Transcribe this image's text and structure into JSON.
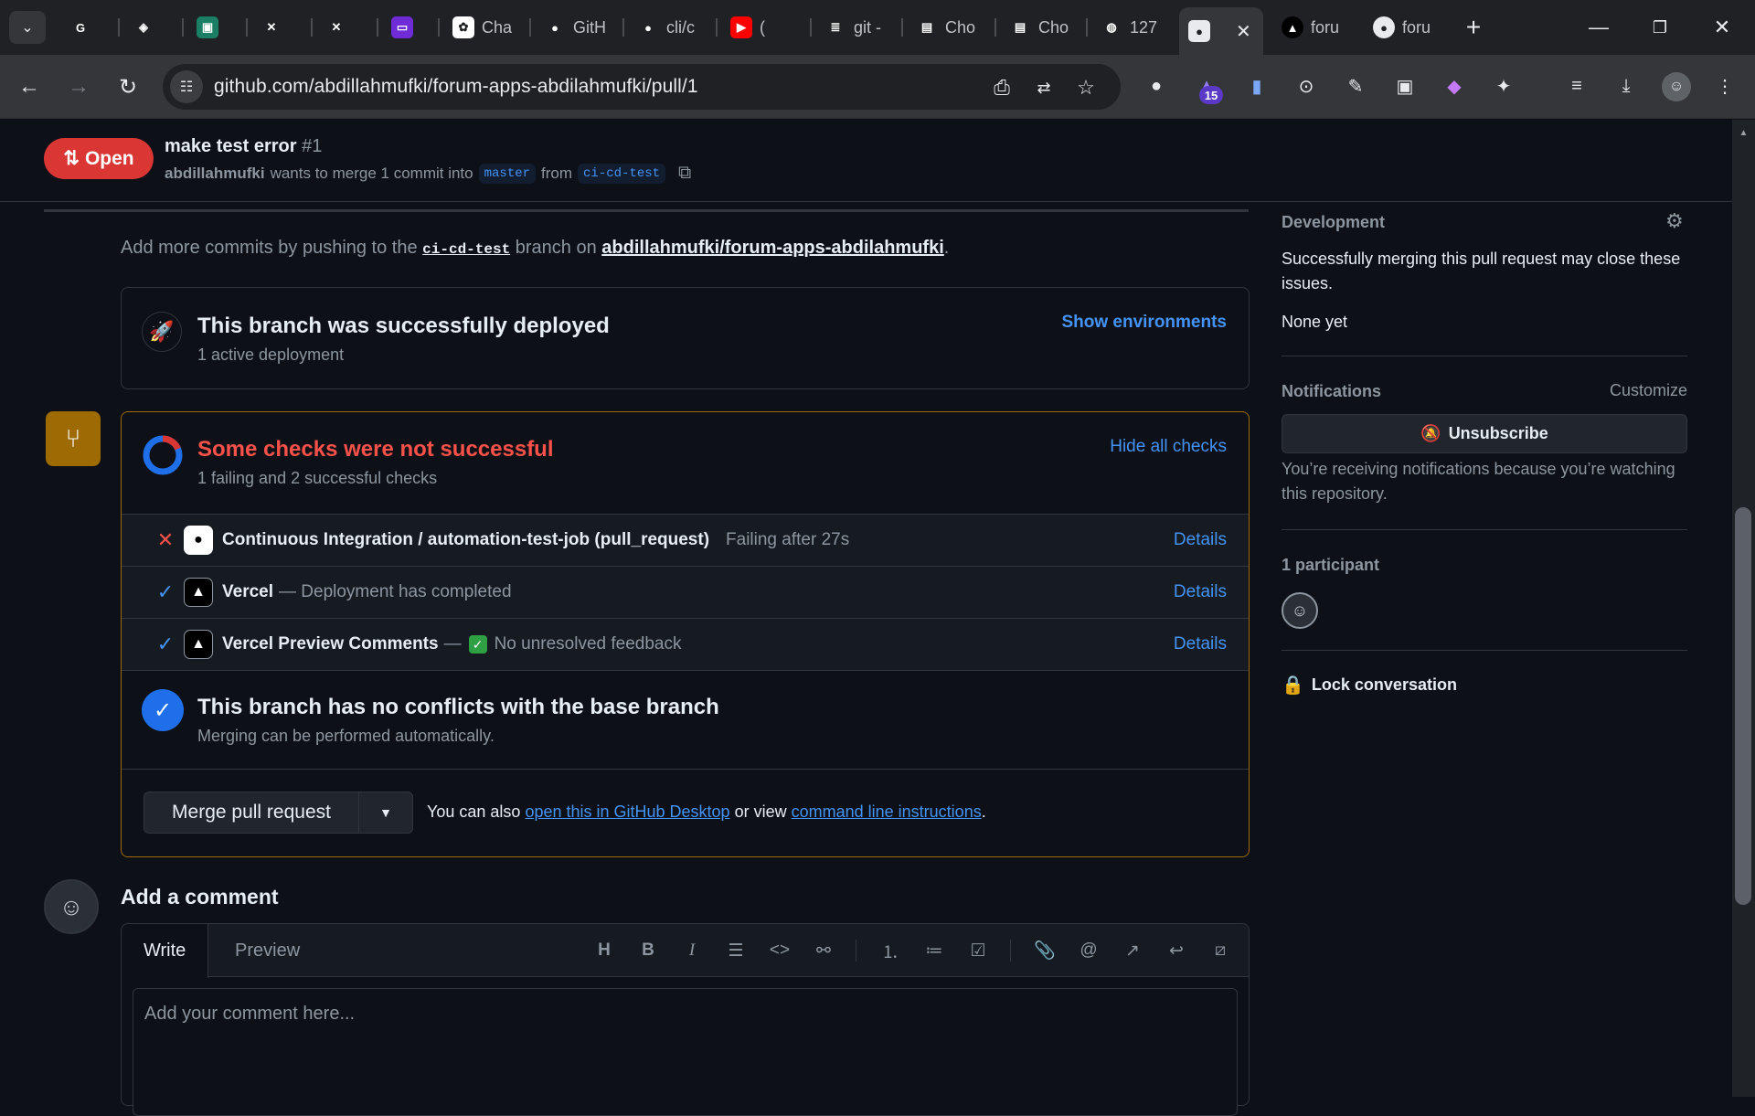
{
  "browser": {
    "tabs": [
      {
        "label": "",
        "fav_color": "#202124",
        "glyph": "G"
      },
      {
        "label": "",
        "fav_color": "#202124",
        "glyph": "◈"
      },
      {
        "label": "",
        "fav_color": "#1a7f64",
        "glyph": "▣"
      },
      {
        "label": "",
        "fav_color": "#202124",
        "glyph": "✕"
      },
      {
        "label": "",
        "fav_color": "#202124",
        "glyph": "✕"
      },
      {
        "label": "",
        "fav_color": "#6e2bd6",
        "glyph": "▭"
      },
      {
        "label": "Cha",
        "fav_color": "#ffffff",
        "glyph": "✿"
      },
      {
        "label": "GitH",
        "fav_color": "#202124",
        "glyph": "●"
      },
      {
        "label": "cli/c",
        "fav_color": "#202124",
        "glyph": "●"
      },
      {
        "label": "(",
        "fav_color": "#ff0000",
        "glyph": "▶"
      },
      {
        "label": "git -",
        "fav_color": "#202124",
        "glyph": "≣"
      },
      {
        "label": "Cho",
        "fav_color": "#202124",
        "glyph": "▤"
      },
      {
        "label": "Cho",
        "fav_color": "#202124",
        "glyph": "▤"
      },
      {
        "label": "127",
        "fav_color": "#202124",
        "glyph": "◍"
      }
    ],
    "active_tab_label": "",
    "after_tabs": [
      {
        "label": "foru",
        "glyph": "▲"
      },
      {
        "label": "foru",
        "glyph": "●"
      }
    ],
    "url": "github.com/abdillahmufki/forum-apps-abdilahmufki/pull/1",
    "ext_badge": "15"
  },
  "pr": {
    "state": "Open",
    "title": "make test error",
    "number": "#1",
    "author": "abdillahmufki",
    "meta_text": "wants to merge 1 commit into",
    "base_branch": "master",
    "from_text": "from",
    "head_branch": "ci-cd-test"
  },
  "hint": {
    "pre": "Add more commits by pushing to the",
    "branch": "ci-cd-test",
    "mid": "branch on",
    "repo": "abdillahmufki/forum-apps-abdilahmufki",
    "post": "."
  },
  "deploy": {
    "title": "This branch was successfully deployed",
    "subtitle": "1 active deployment",
    "link": "Show environments"
  },
  "checks": {
    "title": "Some checks were not successful",
    "subtitle": "1 failing and 2 successful checks",
    "toggle": "Hide all checks",
    "rows": [
      {
        "status": "fail",
        "name": "Continuous Integration / automation-test-job (pull_request)",
        "desc": "Failing after 27s",
        "details": "Details"
      },
      {
        "status": "ok",
        "name": "Vercel",
        "desc": "— Deployment has completed",
        "details": "Details"
      },
      {
        "status": "ok",
        "name": "Vercel Preview Comments",
        "desc": "—",
        "extra": "No unresolved feedback",
        "details": "Details"
      }
    ],
    "conflict_title": "This branch has no conflicts with the base branch",
    "conflict_sub": "Merging can be performed automatically."
  },
  "merge": {
    "button": "Merge pull request",
    "pre": "You can also",
    "link1": "open this in GitHub Desktop",
    "mid": "or view",
    "link2": "command line instructions",
    "post": "."
  },
  "comment": {
    "title": "Add a comment",
    "tab_write": "Write",
    "tab_preview": "Preview",
    "placeholder": "Add your comment here..."
  },
  "sidebar": {
    "development_title": "Development",
    "development_text": "Successfully merging this pull request may close these issues.",
    "development_none": "None yet",
    "notifications_title": "Notifications",
    "customize": "Customize",
    "unsubscribe": "Unsubscribe",
    "notif_reason": "You’re receiving notifications because you’re watching this repository.",
    "participants": "1 participant",
    "lock": "Lock conversation"
  }
}
